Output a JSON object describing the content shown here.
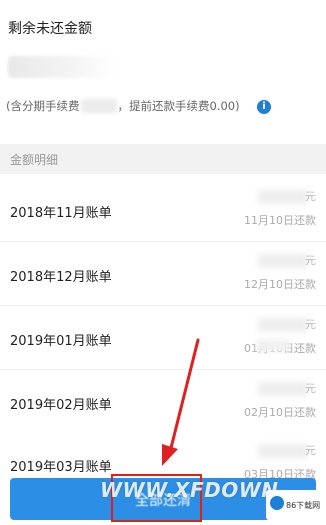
{
  "summary": {
    "title": "剩余未还金额",
    "fee_prefix": "(含分期手续费",
    "fee_suffix": "，提前还款手续费0.00)",
    "info_icon": "i"
  },
  "section": {
    "label": "金额明细"
  },
  "bills": [
    {
      "label": "2018年11月账单",
      "yuan": "元",
      "due": "11月10日还款"
    },
    {
      "label": "2018年12月账单",
      "yuan": "元",
      "due": "12月10日还款"
    },
    {
      "label": "2019年01月账单",
      "yuan": "元",
      "due": "01月10日还款"
    },
    {
      "label": "2019年02月账单",
      "yuan": "元",
      "due": "02月10日还款"
    },
    {
      "label": "2019年03月账单",
      "yuan": "元",
      "due": "03月10日还款"
    }
  ],
  "action": {
    "button_label": "全部还清"
  },
  "overlay": {
    "watermark": "WWW.XFDOWN",
    "logo_text": "86下载网"
  },
  "colors": {
    "accent": "#2d8ee6",
    "info": "#1f7fd6",
    "annotation": "#e02020"
  }
}
